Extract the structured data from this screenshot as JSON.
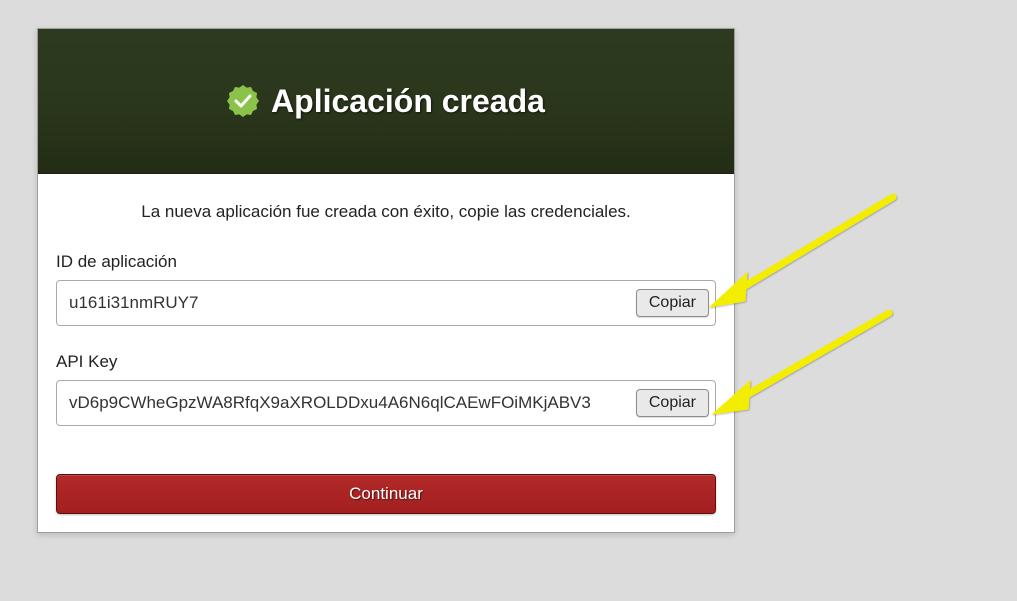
{
  "header": {
    "title": "Aplicación creada",
    "icon": "check-badge-icon"
  },
  "body": {
    "subtitle": "La nueva aplicación fue creada con éxito, copie las credenciales.",
    "appId": {
      "label": "ID de aplicación",
      "value": "u161i31nmRUY7",
      "copyLabel": "Copiar"
    },
    "apiKey": {
      "label": "API Key",
      "value": "vD6p9CWheGpzWA8RfqX9aXROLDDxu4A6N6qlCAEwFOiMKjABV3",
      "copyLabel": "Copiar"
    },
    "continueLabel": "Continuar"
  },
  "annotations": {
    "arrowColor": "#f3ed00"
  }
}
